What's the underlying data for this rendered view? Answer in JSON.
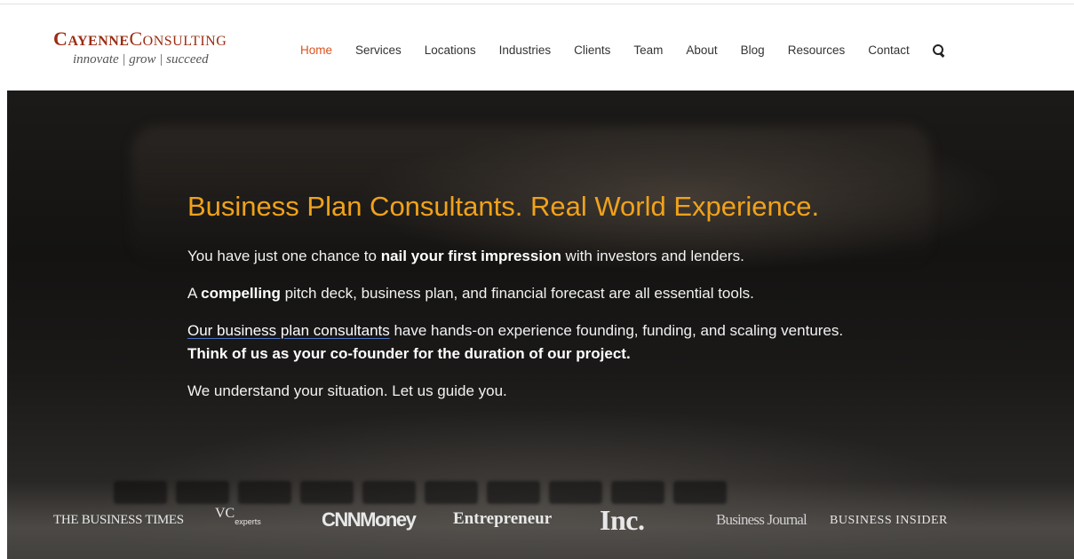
{
  "logo": {
    "name_cayenne": "Cayenne",
    "name_consulting": "Consulting",
    "tagline": "innovate | grow | succeed"
  },
  "nav": {
    "items": [
      "Home",
      "Services",
      "Locations",
      "Industries",
      "Clients",
      "Team",
      "About",
      "Blog",
      "Resources",
      "Contact"
    ],
    "active": "Home",
    "search_icon": "search-icon"
  },
  "hero": {
    "title": "Business Plan Consultants. Real World Experience.",
    "p1_pre": "You have just one chance to ",
    "p1_bold": "nail your first impression",
    "p1_post": " with investors and lenders.",
    "p2_pre": "A ",
    "p2_bold": "compelling",
    "p2_post": " pitch deck, business plan, and financial forecast are all essential tools.",
    "p3_link": "Our business plan consultants",
    "p3_mid": " have hands-on experience founding, funding, and scaling ventures. ",
    "p3_bold": "Think of us as your co-founder for the duration of our project.",
    "p4": "We understand your situation. Let us guide you."
  },
  "press": {
    "business_times": "THE BUSINESS TIMES",
    "vc_main": "VC",
    "vc_sub": "experts",
    "cnn_money": "CNNMoney",
    "entrepreneur": "Entrepreneur",
    "inc": "Inc.",
    "business_journal": "Business Journal",
    "business_insider": "BUSINESS INSIDER"
  },
  "colors": {
    "brand_red": "#9b2c12",
    "nav_active": "#d9531e",
    "hero_title": "#f0a21a",
    "link_underline": "#4a72c4"
  }
}
